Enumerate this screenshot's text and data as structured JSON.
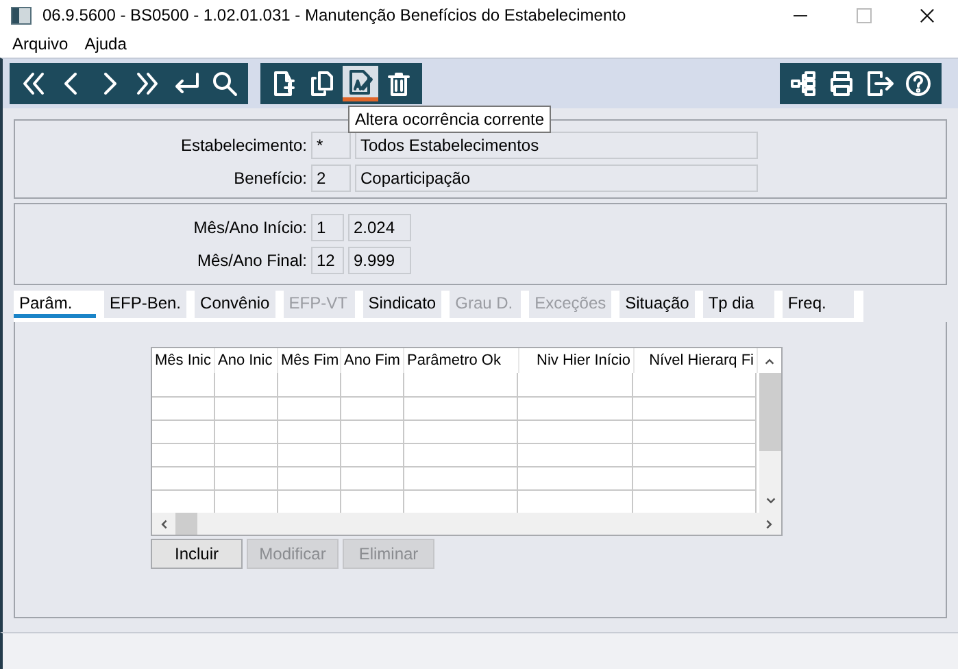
{
  "window": {
    "title": "06.9.5600 - BS0500 - 1.02.01.031 - Manutenção Benefícios do Estabelecimento"
  },
  "menu": [
    "Arquivo",
    "Ajuda"
  ],
  "toolbar_groups": [
    {
      "tools": [
        {
          "selected": false
        },
        {
          "selected": false
        },
        {
          "selected": false
        },
        {
          "selected": false
        },
        {
          "selected": false
        },
        {
          "selected": false
        }
      ]
    },
    {
      "tools": [
        {
          "selected": false
        },
        {
          "selected": false
        },
        {
          "selected": true
        },
        {
          "selected": false
        }
      ]
    },
    {
      "tools": [
        {
          "selected": false
        },
        {
          "selected": false
        },
        {
          "selected": false
        },
        {
          "selected": false
        }
      ]
    }
  ],
  "tooltip": "Altera ocorrência corrente",
  "panels": [
    [
      {
        "label": "Estabelecimento:",
        "code": "*",
        "description": "Todos Estabelecimentos"
      },
      {
        "label": "Benefício:",
        "code": "2",
        "description": "Coparticipação"
      }
    ],
    [
      {
        "label": "Mês/Ano Início:",
        "code": "1",
        "description": "2.024"
      },
      {
        "label": "Mês/Ano Final:",
        "code": "12",
        "description": "9.999"
      }
    ]
  ],
  "tabs": [
    {
      "label": "Parâm.",
      "selected": true,
      "disabled": false
    },
    {
      "label": "EFP-Ben.",
      "selected": false,
      "disabled": false
    },
    {
      "label": "Convênio",
      "selected": false,
      "disabled": false
    },
    {
      "label": "EFP-VT",
      "selected": false,
      "disabled": true
    },
    {
      "label": "Sindicato",
      "selected": false,
      "disabled": false
    },
    {
      "label": "Grau D.",
      "selected": false,
      "disabled": true
    },
    {
      "label": "Exceções",
      "selected": false,
      "disabled": true
    },
    {
      "label": "Situação",
      "selected": false,
      "disabled": false
    },
    {
      "label": "Tp dia",
      "selected": false,
      "disabled": false
    },
    {
      "label": "Freq.",
      "selected": false,
      "disabled": false
    }
  ],
  "table": {
    "columns": [
      "Mês Inic",
      "Ano Inic",
      "Mês Fim",
      "Ano Fim",
      "Parâmetro Ok",
      "Niv Hier Início",
      "Nível Hierarq Fi"
    ]
  },
  "buttons": [
    {
      "label": "Incluir",
      "disabled": false
    },
    {
      "label": "Modificar",
      "disabled": true
    },
    {
      "label": "Eliminar",
      "disabled": true
    }
  ]
}
